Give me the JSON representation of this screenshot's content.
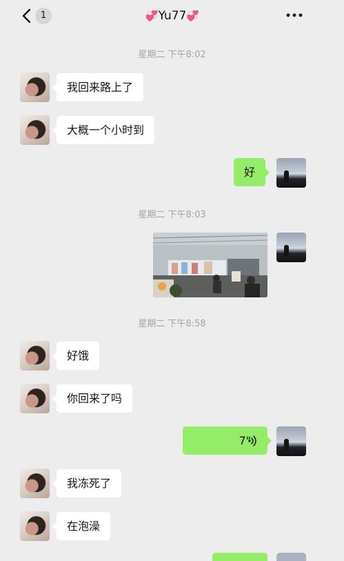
{
  "header": {
    "unread_count": "1",
    "contact_name": "Yu77",
    "heart_left": "💞",
    "heart_right": "💞"
  },
  "messages": {
    "time1": "星期二 下午8:02",
    "m1": "我回来路上了",
    "m2": "大概一个小时到",
    "m3": "好",
    "time2": "星期二 下午8:03",
    "time3": "星期二 下午8:58",
    "m4": "好饿",
    "m5": "你回来了吗",
    "voice_duration": "7\"",
    "m6": "我冻死了",
    "m7": "在泡澡"
  },
  "colors": {
    "background": "#ededed",
    "sent_bubble": "#95ec69",
    "received_bubble": "#ffffff",
    "timestamp": "#a3a3a3"
  },
  "icons": {
    "back": "chevron-left-icon",
    "more": "ellipsis-icon",
    "voice": "voice-wave-icon"
  }
}
